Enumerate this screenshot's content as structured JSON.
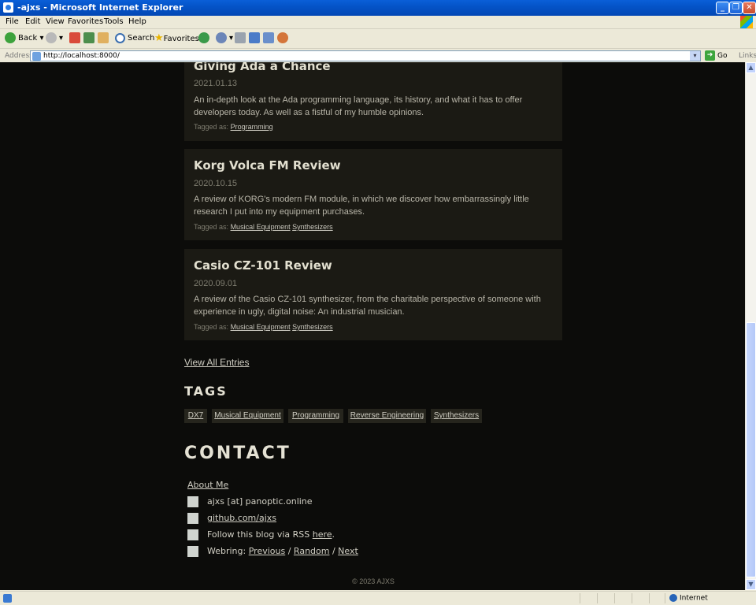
{
  "window": {
    "title": "-ajxs - Microsoft Internet Explorer"
  },
  "menu": [
    "File",
    "Edit",
    "View",
    "Favorites",
    "Tools",
    "Help"
  ],
  "toolbar": {
    "back": "Back",
    "search": "Search",
    "favorites": "Favorites"
  },
  "address": {
    "label": "Address",
    "url": "http://localhost:8000/",
    "go": "Go",
    "links": "Links"
  },
  "posts": [
    {
      "title": "Giving Ada a Chance",
      "date": "2021.01.13",
      "summary": "An in-depth look at the Ada programming language, its history, and what it has to offer developers today. As well as a fistful of my humble opinions.",
      "tagged_label": "Tagged as:",
      "tags": [
        "Programming"
      ]
    },
    {
      "title": "Korg Volca FM Review",
      "date": "2020.10.15",
      "summary": "A review of KORG's modern FM module, in which we discover how embarrassingly little research I put into my equipment purchases.",
      "tagged_label": "Tagged as:",
      "tags": [
        "Musical Equipment",
        "Synthesizers"
      ]
    },
    {
      "title": "Casio CZ-101 Review",
      "date": "2020.09.01",
      "summary": "A review of the Casio CZ-101 synthesizer, from the charitable perspective of someone with experience in ugly, digital noise: An industrial musician.",
      "tagged_label": "Tagged as:",
      "tags": [
        "Musical Equipment",
        "Synthesizers"
      ]
    }
  ],
  "view_all": "View All Entries",
  "tags_section": {
    "heading": "TAGS",
    "tags": [
      "DX7",
      "Musical Equipment",
      "Programming",
      "Reverse Engineering",
      "Synthesizers"
    ]
  },
  "contact": {
    "heading": "CONTACT",
    "about": "About Me",
    "email": "ajxs [at] panoptic.online",
    "github": "github.com/ajxs",
    "rss_prefix": "Follow this blog via RSS ",
    "rss_link": "here",
    "rss_suffix": ".",
    "webring_prefix": "Webring: ",
    "webring_prev": "Previous",
    "webring_random": "Random",
    "webring_next": "Next",
    "sep": " / "
  },
  "footer": "© 2023 AJXS",
  "status": {
    "zone": "Internet"
  }
}
